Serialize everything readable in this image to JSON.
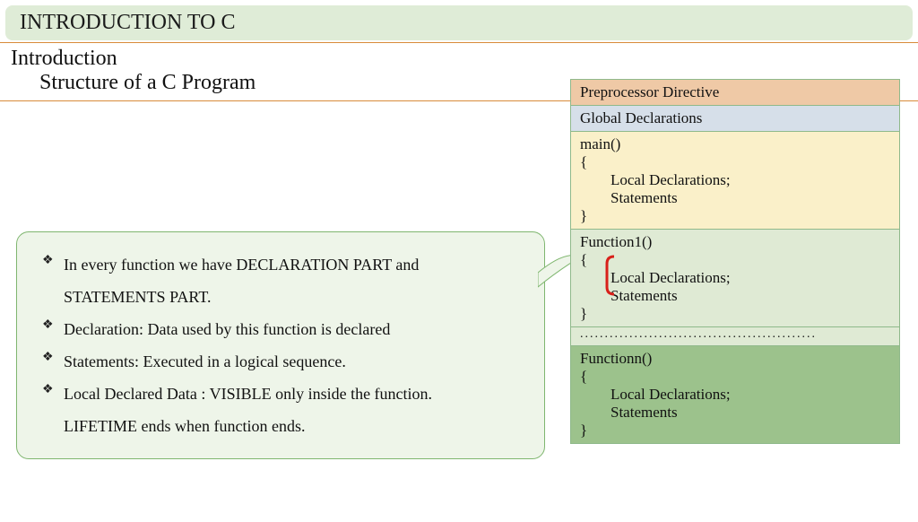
{
  "title": "INTRODUCTION TO C",
  "heading": "Introduction",
  "subheading": "Structure of a C Program",
  "callout": {
    "b1a": "In every function we have DECLARATION PART and",
    "b1b": "STATEMENTS PART.",
    "b2": "Declaration: Data used by this function is declared",
    "b3": "Statements: Executed in a logical sequence.",
    "b4a": "Local Declared Data : VISIBLE only inside the function.",
    "b4b": "LIFETIME ends when function ends."
  },
  "diagram": {
    "preproc": "Preprocessor Directive",
    "globals": "Global Declarations",
    "main": {
      "head": "main()",
      "open": "{",
      "l1": "        Local Declarations;",
      "l2": "        Statements",
      "close": "}"
    },
    "fn1": {
      "head": "Function1()",
      "open": "{",
      "l1": "        Local Declarations;",
      "l2": "        Statements",
      "close": "}"
    },
    "dots": "................................................",
    "fnn": {
      "head": "Functionn()",
      "open": "{",
      "l1": "        Local Declarations;",
      "l2": "        Statements",
      "close": "}"
    }
  }
}
